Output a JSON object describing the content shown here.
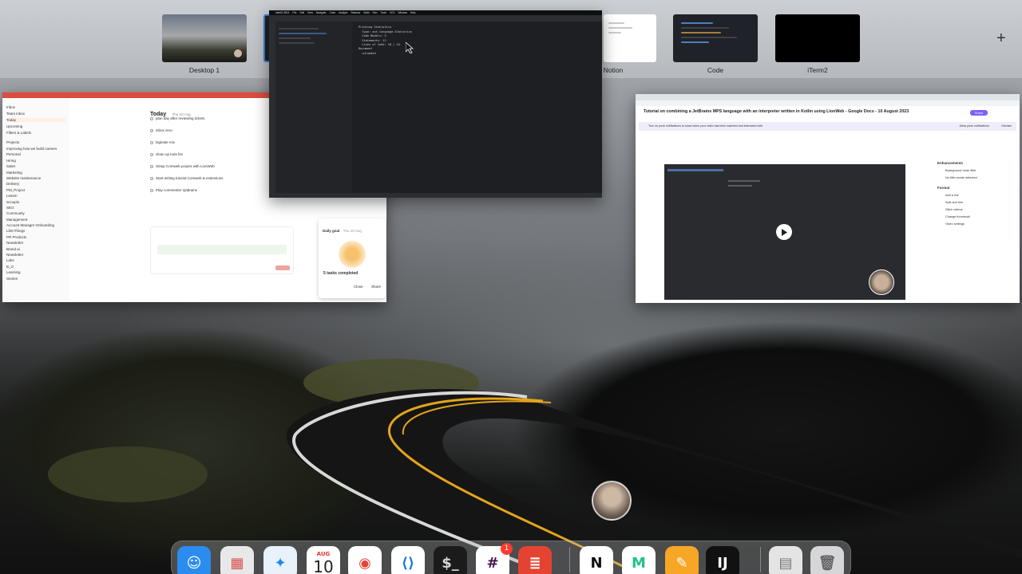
{
  "spaces": [
    {
      "label": "Desktop 1"
    },
    {
      "label": ""
    },
    {
      "label": "Notion"
    },
    {
      "label": "Code"
    },
    {
      "label": "iTerm2"
    }
  ],
  "add_space_glyph": "+",
  "todoist": {
    "today_title": "Today",
    "today_date": "Thu 10 Aug",
    "nav": [
      "Inbox",
      "Team inbox",
      "Today",
      "Upcoming",
      "Filters & Labels"
    ],
    "projects_header": "Projects",
    "projects": [
      "Improving how we build careers",
      "Personal",
      "Hiring",
      "Sales",
      "Marketing",
      "Website maintenance",
      "Delivery",
      "PM_Project",
      "Leasm",
      "Scouplo",
      "SEO",
      "Community",
      "Management",
      "Account Manager Onboarding",
      "LibInThings",
      "PR Products",
      "Newsletter",
      "Brand.ai",
      "Newsletter",
      "Labs",
      "B_O",
      "Learning",
      "Stories"
    ],
    "tasks": [
      "plan day after reviewing tickets",
      "inbox zero",
      "biginate mix",
      "clean up todo list",
      "Setup Comweb project with LionWeb",
      "Start writing tutorial Comweb & extensions",
      "Play commenter Qabrains"
    ],
    "daily_goal_title": "Daily goal",
    "daily_goal_date": "Thu 10 Aug",
    "tasks_completed": "5 tasks completed",
    "close_label": "Close",
    "share_label": "Share"
  },
  "ide": {
    "menu": [
      "IntelliJ IDEA",
      "File",
      "Edit",
      "View",
      "Navigate",
      "Code",
      "Analyze",
      "Refactor",
      "Build",
      "Run",
      "Tools",
      "VCS",
      "Window",
      "Help"
    ],
    "console_lines": [
      "Printing Statistics",
      "  Type: ast.language.Statistics",
      "  Code Models: 3",
      "  Statements: 12",
      "  Lines of Code: 18 / 24",
      "Document",
      "  unloaded"
    ]
  },
  "chrome": {
    "doc_title": "Tutorial on combining a JetBrains MPS language with an interpreter written in Kotlin using LionWeb - Google Docs - 10 August 2023",
    "notice": "Turn on push notifications to know when your video has been watched and interacted with.",
    "notice_action": "Allow push notifications",
    "notice_dismiss": "Dismiss",
    "panel_heading_1": "Enhancements",
    "panel_items_1": [
      "Background noise filter",
      "No filler words detected"
    ],
    "panel_heading_2": "Format",
    "panel_items_2": [
      "Add a link",
      "Split and trim",
      "Stitch videos",
      "Change thumbnail",
      "Video settings"
    ],
    "share_label": "Share"
  },
  "dock": [
    {
      "name": "finder",
      "glyph": "☺",
      "bg": "#2b8cf0",
      "fg": "#ffffff"
    },
    {
      "name": "launchpad",
      "glyph": "▦",
      "bg": "#e8e8ea",
      "fg": "#d94f4f"
    },
    {
      "name": "safari",
      "glyph": "✦",
      "bg": "#e9f1fb",
      "fg": "#1a8cf0"
    },
    {
      "name": "calendar-month",
      "glyph": "AUG",
      "bg": "#ffffff",
      "fg": "#e0392f"
    },
    {
      "name": "chrome",
      "glyph": "◉",
      "bg": "#ffffff",
      "fg": "#e8443a"
    },
    {
      "name": "vscode",
      "glyph": "⟨⟩",
      "bg": "#ffffff",
      "fg": "#1f7ad8"
    },
    {
      "name": "terminal",
      "glyph": "$_",
      "bg": "#1b1b1b",
      "fg": "#d8d8d8"
    },
    {
      "name": "slack",
      "glyph": "#",
      "bg": "#ffffff",
      "fg": "#4a154b"
    },
    {
      "name": "todoist",
      "glyph": "≣",
      "bg": "#e44332",
      "fg": "#ffffff"
    },
    {
      "name": "notion",
      "glyph": "N",
      "bg": "#ffffff",
      "fg": "#111111"
    },
    {
      "name": "mps",
      "glyph": "M",
      "bg": "#ffffff",
      "fg": "#21c28f"
    },
    {
      "name": "pages",
      "glyph": "✎",
      "bg": "#f7a626",
      "fg": "#ffffff"
    },
    {
      "name": "intellij",
      "glyph": "IJ",
      "bg": "#111111",
      "fg": "#ffffff"
    },
    {
      "name": "documents-stack",
      "glyph": "▤",
      "bg": "#e4e4e4",
      "fg": "#777777"
    },
    {
      "name": "trash",
      "glyph": "🗑",
      "bg": "#d6d6d8",
      "fg": "#666666"
    }
  ],
  "calendar_day": "10",
  "slack_badge": "1",
  "colors": {
    "todoist_red": "#db4c3f",
    "chrome_accent": "#7b61ff"
  }
}
